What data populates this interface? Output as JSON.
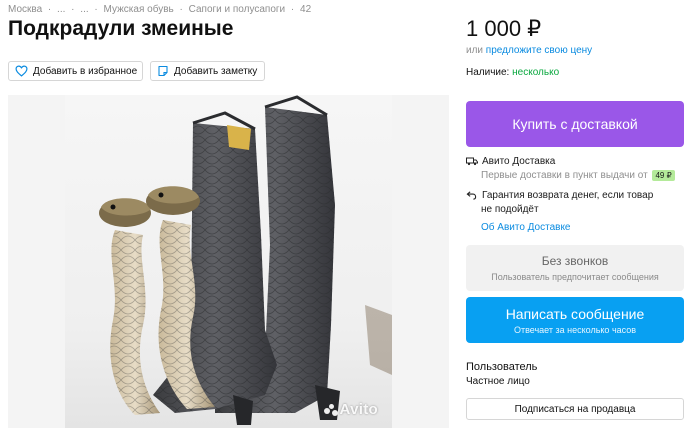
{
  "breadcrumb": [
    "Москва",
    "·",
    "...",
    "·",
    "...",
    "·",
    "Мужская обувь",
    "·",
    "Сапоги и полусапоги",
    "·",
    "42"
  ],
  "title": "Подкрадули змеиные",
  "actions": {
    "favorite_label": "Добавить в избранное",
    "note_label": "Добавить заметку",
    "favorite_icon": "heart-icon",
    "note_icon": "note-icon"
  },
  "gallery": {
    "watermark": "Avito"
  },
  "price": {
    "value": "1 000 ₽",
    "sub_prefix": "или ",
    "sub_link": "предложите свою цену"
  },
  "availability": {
    "label": "Наличие: ",
    "value": "несколько",
    "value_color": "#0aa83f"
  },
  "buy_button": {
    "label": "Купить с доставкой",
    "color": "#9a57e8"
  },
  "delivery": {
    "icon": "truck-icon",
    "title": "Авито Доставка",
    "note": "Первые доставки в пункт выдачи от",
    "badge": "49 ₽"
  },
  "guarantee": {
    "icon": "return-arrow-icon",
    "line1": "Гарантия возврата денег, если товар",
    "line2": "не подойдёт",
    "link": "Об Авито Доставке"
  },
  "no_calls": {
    "title": "Без звонков",
    "subtitle": "Пользователь предпочитает сообщения"
  },
  "message_button": {
    "label": "Написать сообщение",
    "subtitle": "Отвечает за несколько часов",
    "color": "#08a0f2"
  },
  "seller": {
    "name": "Пользователь",
    "type": "Частное лицо"
  },
  "subscribe_button": {
    "label": "Подписаться на продавца"
  }
}
